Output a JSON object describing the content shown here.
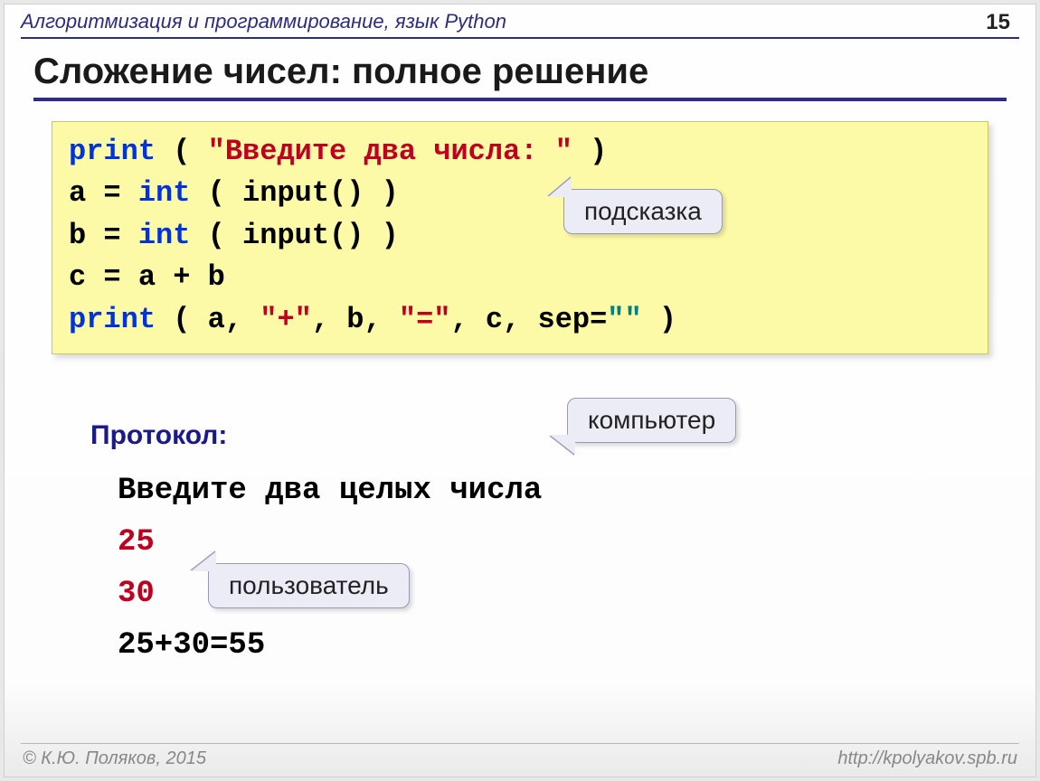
{
  "header": {
    "course": "Алгоритмизация и программирование,  язык Python",
    "page": "15"
  },
  "title": "Сложение чисел: полное решение",
  "code": {
    "print1_kw": "print",
    "print1_open": " ( ",
    "print1_str": "\"Введите два числа: \"",
    "print1_close": " )",
    "line2_a": "a = ",
    "line2_int": "int",
    "line2_rest": " ( input() )",
    "line3_a": "b = ",
    "line3_int": "int",
    "line3_rest": " ( input() )",
    "line4": "c = a + b",
    "print5_kw": "print",
    "print5_a": " ( a, ",
    "print5_s1": "\"+\"",
    "print5_b": ", b, ",
    "print5_s2": "\"=\"",
    "print5_c": ", c, sep=",
    "print5_s3": "\"\"",
    "print5_close": " )"
  },
  "callouts": {
    "hint": "подсказка",
    "computer": "компьютер",
    "user": "пользователь"
  },
  "protocol": {
    "label": "Протокол:",
    "prompt": "Введите два целых числа",
    "in1": "25",
    "in2": "30",
    "out": "25+30=55"
  },
  "footer": {
    "left": "© К.Ю. Поляков, 2015",
    "right": "http://kpolyakov.spb.ru"
  }
}
